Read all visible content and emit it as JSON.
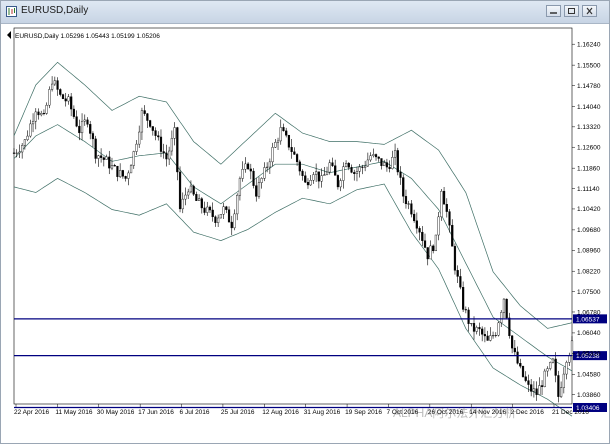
{
  "window": {
    "title": "EURUSD,Daily",
    "icons": [
      "chart-window-icon",
      "minimize-icon",
      "maximize-icon",
      "close-icon"
    ]
  },
  "chart_data": {
    "type": "candlestick",
    "symbol": "EURUSD",
    "timeframe": "Daily",
    "info_line": "EURUSD,Daily  1.05296 1.05443 1.05199 1.05206",
    "ohlc_last": {
      "open": 1.05296,
      "high": 1.05443,
      "low": 1.05199,
      "close": 1.05206
    },
    "ylim": [
      1.036,
      1.166
    ],
    "y_ticks": [
      "1.16240",
      "1.15500",
      "1.14780",
      "1.14040",
      "1.13320",
      "1.12600",
      "1.11860",
      "1.11140",
      "1.10420",
      "1.09680",
      "1.08960",
      "1.08220",
      "1.07500",
      "1.06780",
      "1.06040",
      "1.05320",
      "1.04580",
      "1.03860"
    ],
    "x_ticks": [
      "22 Apr 2016",
      "11 May 2016",
      "30 May 2016",
      "17 Jun 2016",
      "6 Jul 2016",
      "25 Jul 2016",
      "12 Aug 2016",
      "31 Aug 2016",
      "19 Sep 2016",
      "7 Oct 2016",
      "26 Oct 2016",
      "14 Nov 2016",
      "2 Dec 2016",
      "21 Dec 2016"
    ],
    "levels": [
      {
        "price": 1.06537,
        "label": "1.06537",
        "color": "#000080"
      },
      {
        "price": 1.05238,
        "label": "1.05238",
        "color": "#000080"
      },
      {
        "price": 1.03406,
        "label": "1.03406",
        "color": "#000080"
      }
    ],
    "indicator": "Bollinger Bands",
    "bands_color": "#3f6f66",
    "candle_color": "#000000",
    "path_points": [
      [
        0,
        1.124
      ],
      [
        4,
        1.128
      ],
      [
        8,
        1.14
      ],
      [
        11,
        1.136
      ],
      [
        14,
        1.15
      ],
      [
        17,
        1.144
      ],
      [
        20,
        1.142
      ],
      [
        24,
        1.132
      ],
      [
        27,
        1.136
      ],
      [
        30,
        1.124
      ],
      [
        34,
        1.121
      ],
      [
        37,
        1.118
      ],
      [
        41,
        1.115
      ],
      [
        44,
        1.124
      ],
      [
        47,
        1.138
      ],
      [
        50,
        1.135
      ],
      [
        53,
        1.128
      ],
      [
        56,
        1.122
      ],
      [
        59,
        1.131
      ],
      [
        61,
        1.104
      ],
      [
        64,
        1.112
      ],
      [
        67,
        1.107
      ],
      [
        70,
        1.104
      ],
      [
        74,
        1.101
      ],
      [
        77,
        1.104
      ],
      [
        80,
        1.099
      ],
      [
        83,
        1.115
      ],
      [
        86,
        1.12
      ],
      [
        89,
        1.11
      ],
      [
        92,
        1.117
      ],
      [
        95,
        1.125
      ],
      [
        98,
        1.132
      ],
      [
        101,
        1.127
      ],
      [
        104,
        1.121
      ],
      [
        107,
        1.113
      ],
      [
        110,
        1.118
      ],
      [
        113,
        1.114
      ],
      [
        116,
        1.12
      ],
      [
        119,
        1.113
      ],
      [
        122,
        1.122
      ],
      [
        125,
        1.117
      ],
      [
        128,
        1.119
      ],
      [
        131,
        1.123
      ],
      [
        134,
        1.121
      ],
      [
        137,
        1.119
      ],
      [
        140,
        1.123
      ],
      [
        143,
        1.109
      ],
      [
        146,
        1.104
      ],
      [
        149,
        1.097
      ],
      [
        152,
        1.088
      ],
      [
        155,
        1.093
      ],
      [
        157,
        1.112
      ],
      [
        159,
        1.103
      ],
      [
        162,
        1.084
      ],
      [
        165,
        1.07
      ],
      [
        168,
        1.062
      ],
      [
        171,
        1.061
      ],
      [
        174,
        1.057
      ],
      [
        177,
        1.061
      ],
      [
        180,
        1.073
      ],
      [
        183,
        1.055
      ],
      [
        186,
        1.047
      ],
      [
        189,
        1.041
      ],
      [
        192,
        1.039
      ],
      [
        195,
        1.045
      ],
      [
        198,
        1.05
      ],
      [
        200,
        1.038
      ],
      [
        203,
        1.052
      ],
      [
        205,
        1.056
      ]
    ],
    "bands_upper": [
      [
        0,
        1.13
      ],
      [
        8,
        1.148
      ],
      [
        16,
        1.156
      ],
      [
        26,
        1.148
      ],
      [
        36,
        1.139
      ],
      [
        46,
        1.144
      ],
      [
        56,
        1.142
      ],
      [
        66,
        1.128
      ],
      [
        76,
        1.12
      ],
      [
        86,
        1.129
      ],
      [
        96,
        1.138
      ],
      [
        106,
        1.131
      ],
      [
        116,
        1.128
      ],
      [
        126,
        1.128
      ],
      [
        136,
        1.127
      ],
      [
        146,
        1.132
      ],
      [
        156,
        1.125
      ],
      [
        166,
        1.11
      ],
      [
        176,
        1.082
      ],
      [
        186,
        1.07
      ],
      [
        196,
        1.062
      ],
      [
        205,
        1.064
      ]
    ],
    "bands_middle": [
      [
        0,
        1.122
      ],
      [
        8,
        1.13
      ],
      [
        16,
        1.134
      ],
      [
        26,
        1.128
      ],
      [
        36,
        1.121
      ],
      [
        46,
        1.123
      ],
      [
        56,
        1.124
      ],
      [
        66,
        1.112
      ],
      [
        76,
        1.106
      ],
      [
        86,
        1.113
      ],
      [
        96,
        1.12
      ],
      [
        106,
        1.12
      ],
      [
        116,
        1.117
      ],
      [
        126,
        1.119
      ],
      [
        136,
        1.121
      ],
      [
        146,
        1.115
      ],
      [
        156,
        1.104
      ],
      [
        166,
        1.085
      ],
      [
        176,
        1.066
      ],
      [
        186,
        1.059
      ],
      [
        196,
        1.052
      ],
      [
        205,
        1.047
      ]
    ],
    "bands_lower": [
      [
        0,
        1.112
      ],
      [
        8,
        1.11
      ],
      [
        16,
        1.115
      ],
      [
        26,
        1.11
      ],
      [
        36,
        1.104
      ],
      [
        46,
        1.102
      ],
      [
        56,
        1.106
      ],
      [
        66,
        1.096
      ],
      [
        76,
        1.093
      ],
      [
        86,
        1.097
      ],
      [
        96,
        1.103
      ],
      [
        106,
        1.108
      ],
      [
        116,
        1.106
      ],
      [
        126,
        1.111
      ],
      [
        136,
        1.113
      ],
      [
        146,
        1.096
      ],
      [
        156,
        1.083
      ],
      [
        166,
        1.062
      ],
      [
        176,
        1.048
      ],
      [
        186,
        1.042
      ],
      [
        196,
        1.037
      ],
      [
        205,
        1.031
      ]
    ]
  },
  "watermark": "ALPHA阿尔法外汇分析"
}
